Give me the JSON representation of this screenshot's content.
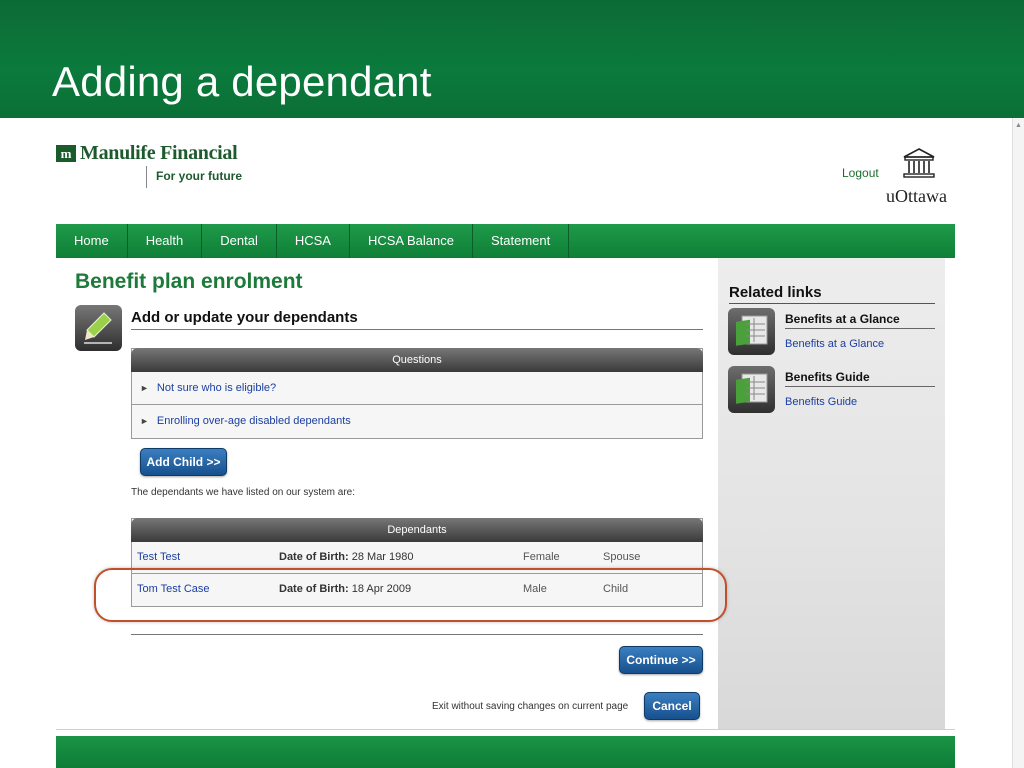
{
  "slide": {
    "title": "Adding a dependant"
  },
  "brand": {
    "name": "Manulife Financial",
    "tagline": "For your future"
  },
  "header": {
    "logout_label": "Logout",
    "university": "uOttawa"
  },
  "nav": {
    "items": [
      "Home",
      "Health",
      "Dental",
      "HCSA",
      "HCSA Balance",
      "Statement"
    ]
  },
  "main": {
    "page_title": "Benefit plan enrolment",
    "section_title": "Add or update your dependants",
    "questions": {
      "header": "Questions",
      "items": [
        "Not sure who is eligible?",
        "Enrolling over-age disabled dependants"
      ]
    },
    "add_child_label": "Add Child >>",
    "listed_text": "The dependants we have listed on our system are:",
    "dependants": {
      "header": "Dependants",
      "dob_label": "Date of Birth:",
      "rows": [
        {
          "name": "Test Test",
          "dob": "28 Mar 1980",
          "gender": "Female",
          "relationship": "Spouse"
        },
        {
          "name": "Tom Test Case",
          "dob": "18 Apr 2009",
          "gender": "Male",
          "relationship": "Child"
        }
      ]
    },
    "continue_label": "Continue >>",
    "exit_text": "Exit without saving changes on current page",
    "cancel_label": "Cancel"
  },
  "sidebar": {
    "title": "Related links",
    "items": [
      {
        "heading": "Benefits at a Glance",
        "link": "Benefits at a Glance"
      },
      {
        "heading": "Benefits Guide",
        "link": "Benefits Guide"
      }
    ]
  },
  "colors": {
    "brand_green": "#0b7a3c",
    "link_blue": "#1b3fa0",
    "button_blue": "#17508d",
    "highlight_ring": "#c0502a"
  }
}
